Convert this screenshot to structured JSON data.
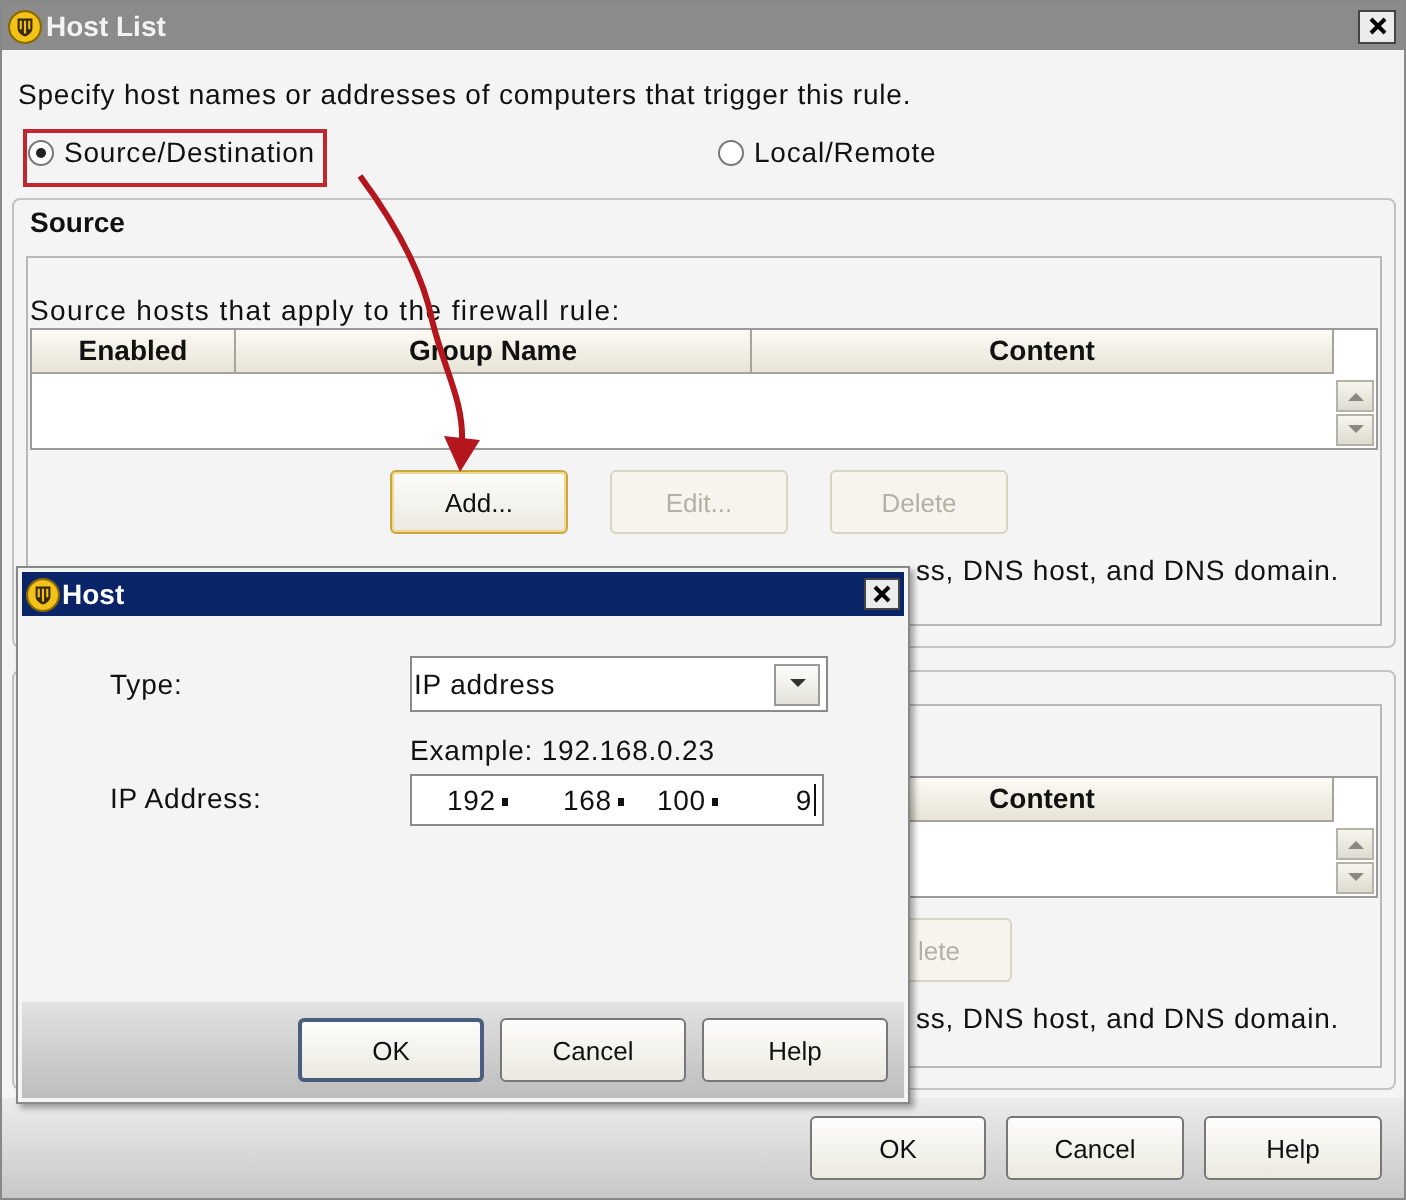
{
  "window": {
    "title": "Host List"
  },
  "description": "Specify host names or addresses of computers that trigger this rule.",
  "mode_options": [
    {
      "label": "Source/Destination",
      "selected": true
    },
    {
      "label": "Local/Remote",
      "selected": false
    }
  ],
  "source": {
    "title": "Source",
    "caption": "Source hosts that apply to the firewall rule:",
    "columns": [
      "Enabled",
      "Group Name",
      "Content"
    ],
    "buttons": [
      {
        "label": "Add...",
        "disabled": false
      },
      {
        "label": "Edit...",
        "disabled": true
      },
      {
        "label": "Delete",
        "disabled": true
      }
    ],
    "note": "ss, DNS host, and DNS domain."
  },
  "destination": {
    "columns": [
      "Content"
    ],
    "buttons": [
      {
        "label": "lete",
        "disabled": true
      }
    ],
    "note": "ss, DNS host, and DNS domain."
  },
  "buttons": [
    "OK",
    "Cancel",
    "Help"
  ],
  "dialog": {
    "title": "Host",
    "fields": [
      {
        "kind": "select",
        "label": "Type:",
        "value": "IP address"
      },
      {
        "kind": "ip",
        "label": "IP Address:",
        "hint": "Example: 192.168.0.23",
        "octets": [
          "192",
          "168",
          "100",
          "9"
        ]
      }
    ],
    "buttons": [
      {
        "label": "OK",
        "focused": true
      },
      {
        "label": "Cancel",
        "focused": false
      },
      {
        "label": "Help",
        "focused": false
      }
    ]
  }
}
